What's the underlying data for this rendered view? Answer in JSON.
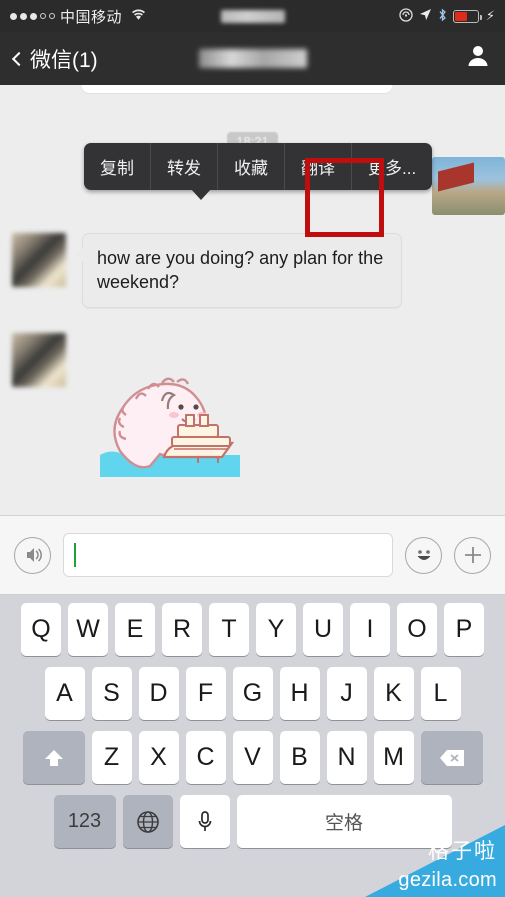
{
  "status_bar": {
    "carrier": "中国移动",
    "signal_dots_filled": 3,
    "signal_dots_total": 5,
    "wifi_icon": "wifi-icon",
    "rotation_lock_icon": "rotation-lock-icon",
    "location_icon": "location-arrow-icon",
    "bluetooth_icon": "bluetooth-icon",
    "battery_icon": "battery-low-icon",
    "battery_color": "#e02a1c",
    "charging_icon": "lightning-bolt-icon",
    "center_title_blurred": true
  },
  "nav_bar": {
    "back_label": "微信(1)",
    "back_icon": "chevron-left-icon",
    "title_blurred": true,
    "contact_icon": "person-icon",
    "background": "#2e2e2e"
  },
  "chat": {
    "timestamp": "18:21",
    "messages": [
      {
        "sender": "other",
        "type": "text",
        "text": "how are you doing? any plan for the weekend?"
      },
      {
        "sender": "other",
        "type": "sticker",
        "sticker_name": "pink-dinosaur-pushing-boat-sticker"
      }
    ],
    "background": "#ededed"
  },
  "context_menu": {
    "items": [
      {
        "label": "复制",
        "name": "copy"
      },
      {
        "label": "转发",
        "name": "forward"
      },
      {
        "label": "收藏",
        "name": "favorite"
      },
      {
        "label": "翻译",
        "name": "translate"
      },
      {
        "label": "更多...",
        "name": "more"
      }
    ],
    "highlighted_item": "翻译",
    "highlight_color": "#c00d0d",
    "background": "#333335"
  },
  "input_bar": {
    "voice_icon": "voice-record-icon",
    "text_value": "",
    "emoji_icon": "smiley-face-icon",
    "add_icon": "plus-circle-icon"
  },
  "keyboard": {
    "row1": [
      "Q",
      "W",
      "E",
      "R",
      "T",
      "Y",
      "U",
      "I",
      "O",
      "P"
    ],
    "row2": [
      "A",
      "S",
      "D",
      "F",
      "G",
      "H",
      "J",
      "K",
      "L"
    ],
    "row3": [
      "Z",
      "X",
      "C",
      "V",
      "B",
      "N",
      "M"
    ],
    "shift_icon": "shift-up-arrow-icon",
    "backspace_icon": "backspace-delete-icon",
    "number_key": "123",
    "globe_icon": "globe-language-icon",
    "mic_icon": "microphone-icon",
    "space_label": "空格"
  },
  "watermark": {
    "cn": "格子啦",
    "en": "gezila.com",
    "color": "#37abe0"
  }
}
